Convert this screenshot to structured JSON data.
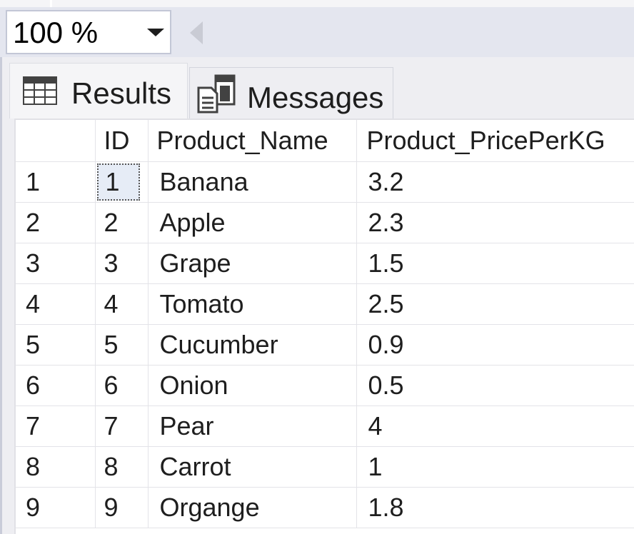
{
  "toolbar": {
    "zoom_value": "100 %"
  },
  "tabs": [
    {
      "label": "Results",
      "icon": "grid-icon"
    },
    {
      "label": "Messages",
      "icon": "messages-icon"
    }
  ],
  "grid": {
    "columns": [
      "",
      "ID",
      "Product_Name",
      "Product_PricePerKG"
    ],
    "rows": [
      {
        "num": "1",
        "id": "1",
        "name": "Banana",
        "price": "3.2"
      },
      {
        "num": "2",
        "id": "2",
        "name": "Apple",
        "price": "2.3"
      },
      {
        "num": "3",
        "id": "3",
        "name": "Grape",
        "price": "1.5"
      },
      {
        "num": "4",
        "id": "4",
        "name": "Tomato",
        "price": "2.5"
      },
      {
        "num": "5",
        "id": "5",
        "name": "Cucumber",
        "price": "0.9"
      },
      {
        "num": "6",
        "id": "6",
        "name": "Onion",
        "price": "0.5"
      },
      {
        "num": "7",
        "id": "7",
        "name": "Pear",
        "price": "4"
      },
      {
        "num": "8",
        "id": "8",
        "name": "Carrot",
        "price": "1"
      },
      {
        "num": "9",
        "id": "9",
        "name": "Organge",
        "price": "1.8"
      }
    ]
  }
}
